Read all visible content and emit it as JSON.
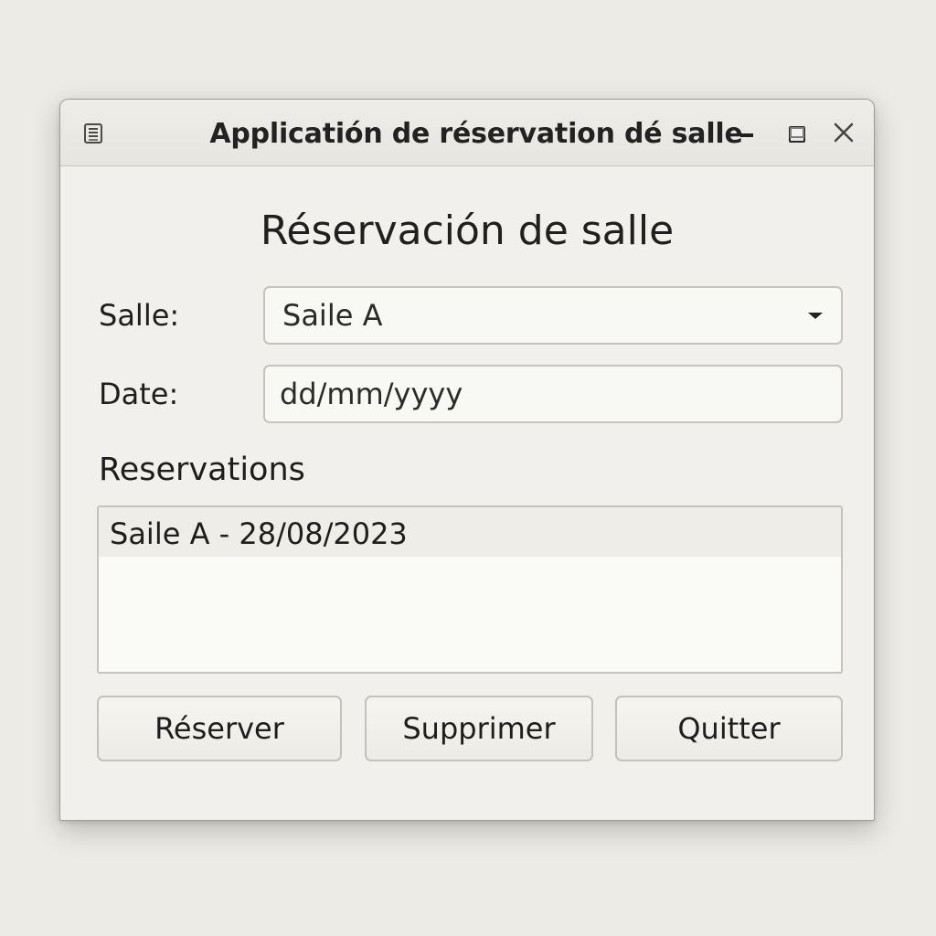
{
  "window": {
    "title": "Applicatión de réservation dé salle"
  },
  "titlebar": {
    "app_icon": "document-list-icon",
    "minimize_icon": "minimize-icon",
    "maximize_icon": "maximize-icon",
    "close_icon": "close-icon"
  },
  "form": {
    "heading": "Réservación de salle",
    "salle_label": "Salle:",
    "salle_value": "Saile A",
    "date_label": "Date:",
    "date_placeholder": "dd/mm/yyyy"
  },
  "reservations": {
    "title": "Reservations",
    "items": [
      {
        "label": "Saile A - 28/08/2023"
      }
    ]
  },
  "buttons": {
    "reserver": "Réserver",
    "supprimer": "Supprimer",
    "quitter": "Quitter"
  },
  "colors": {
    "background": "#ecebe6",
    "window": "#f1f0ec",
    "field": "#f8f8f4",
    "border": "#c4c3be",
    "selected_row": "#eeede8"
  }
}
